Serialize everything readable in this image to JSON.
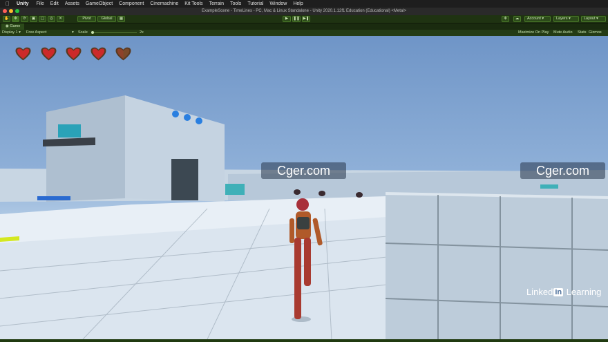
{
  "menubar": {
    "app_name": "Unity",
    "items": [
      "File",
      "Edit",
      "Assets",
      "GameObject",
      "Component",
      "Cinemachine",
      "Kit Tools",
      "Terrain",
      "Tools",
      "Tutorial",
      "Window",
      "Help"
    ]
  },
  "window": {
    "title": "ExampleScene - TimeLines - PC, Mac & Linux Standalone - Unity 2020.1.12f1 Education (Educational) <Metal>"
  },
  "toolbar": {
    "pivot_label": "Pivot",
    "global_label": "Global",
    "account_label": "Account",
    "layers_label": "Layers",
    "layout_label": "Layout"
  },
  "game_tab": {
    "label": "Game"
  },
  "game_bar": {
    "display": "Display 1",
    "aspect": "Free Aspect",
    "scale_label": "Scale",
    "scale_value": "2x",
    "maximize": "Maximize On Play",
    "mute": "Mute Audio",
    "stats": "Stats",
    "gizmos": "Gizmos"
  },
  "hud": {
    "hearts": [
      1,
      1,
      1,
      1,
      0.5
    ],
    "colors": {
      "heart_full": "#cc2a2a",
      "heart_frame": "#5a3a20",
      "heart_empty": "#7a4a2a"
    }
  },
  "watermarks": [
    "Cger.com",
    "Cger.com"
  ],
  "branding": {
    "left": "Linked",
    "mark": "in",
    "right": " Learning"
  },
  "colors": {
    "toolbar_bg": "#1f3312",
    "accent_green": "#4a7a28",
    "sky_top": "#6f95c7"
  }
}
